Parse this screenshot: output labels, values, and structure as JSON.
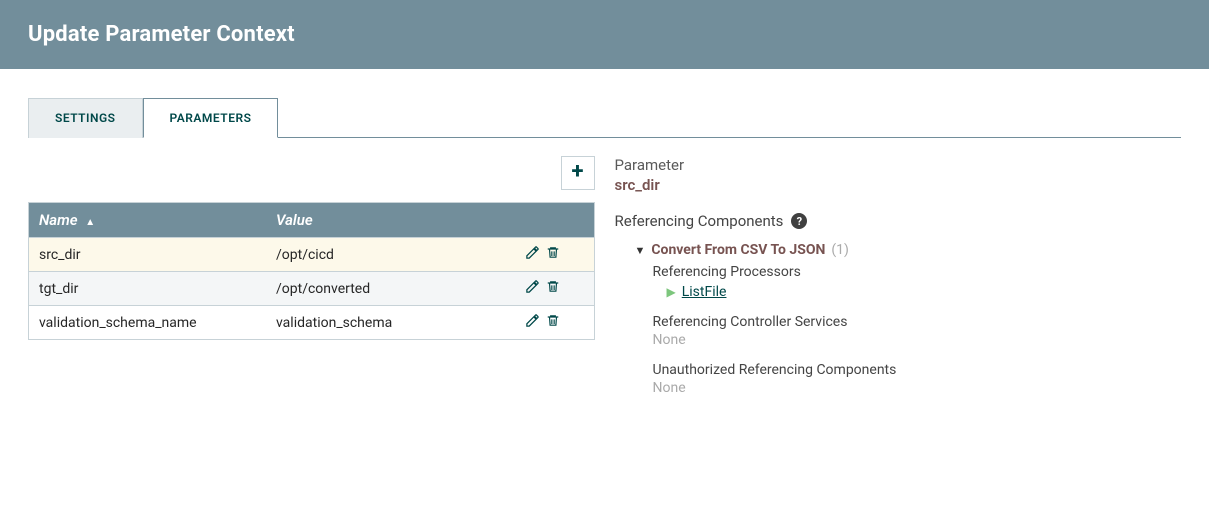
{
  "header": {
    "title": "Update Parameter Context"
  },
  "tabs": {
    "settings": "SETTINGS",
    "parameters": "PARAMETERS"
  },
  "table": {
    "columns": {
      "name": "Name",
      "value": "Value"
    },
    "rows": [
      {
        "name": "src_dir",
        "value": "/opt/cicd",
        "selected": true
      },
      {
        "name": "tgt_dir",
        "value": "/opt/converted",
        "selected": false
      },
      {
        "name": "validation_schema_name",
        "value": "validation_schema",
        "selected": false
      }
    ]
  },
  "right": {
    "param_label": "Parameter",
    "param_name": "src_dir",
    "ref_label": "Referencing Components",
    "group": {
      "name": "Convert From CSV To JSON",
      "count": "(1)"
    },
    "ref_processors_label": "Referencing Processors",
    "processor": "ListFile",
    "ref_services_label": "Referencing Controller Services",
    "ref_services_value": "None",
    "unauth_label": "Unauthorized Referencing Components",
    "unauth_value": "None"
  }
}
